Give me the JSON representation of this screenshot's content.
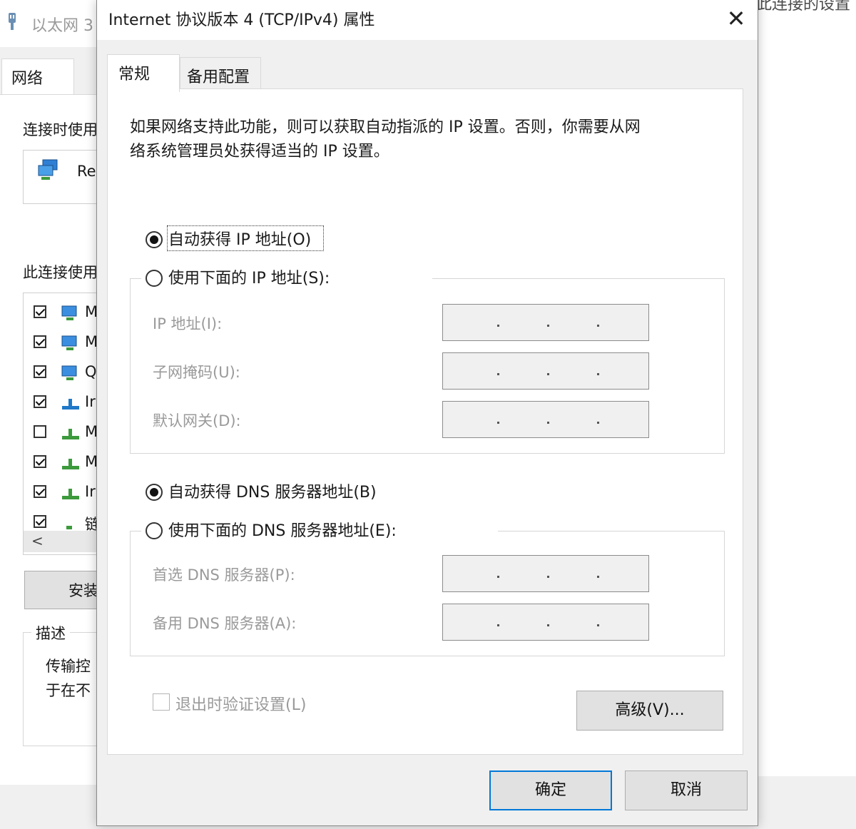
{
  "background_window": {
    "title": "以太网 3",
    "right_title": "此连接的设置",
    "tab_label": "网络",
    "connect_using_label": "连接时使用",
    "adapter_text": "Re",
    "items_label": "此连接使用",
    "items": [
      {
        "checked": true,
        "text": "M"
      },
      {
        "checked": true,
        "text": "M"
      },
      {
        "checked": true,
        "text": "Q"
      },
      {
        "checked": true,
        "text": "Ir"
      },
      {
        "checked": false,
        "text": "M"
      },
      {
        "checked": true,
        "text": "M"
      },
      {
        "checked": true,
        "text": "Ir"
      },
      {
        "checked": true,
        "text": "链"
      }
    ],
    "scroll_left_glyph": "<",
    "install_label": "安装",
    "description_title": "描述",
    "description_line1": "传输控",
    "description_line2": "于在不"
  },
  "dialog": {
    "title": "Internet 协议版本 4 (TCP/IPv4) 属性",
    "close_glyph": "✕",
    "tabs": [
      {
        "label": "常规",
        "selected": true
      },
      {
        "label": "备用配置",
        "selected": false
      }
    ],
    "intro_line1": "如果网络支持此功能，则可以获取自动指派的 IP 设置。否则，你需要从网",
    "intro_line2": "络系统管理员处获得适当的 IP 设置。",
    "ip_auto": {
      "label": "自动获得 IP 地址(O)",
      "selected": true
    },
    "ip_manual": {
      "label": "使用下面的 IP 地址(S):",
      "selected": false
    },
    "ip_fields": [
      {
        "label": "IP 地址(I):",
        "value": ""
      },
      {
        "label": "子网掩码(U):",
        "value": ""
      },
      {
        "label": "默认网关(D):",
        "value": ""
      }
    ],
    "dns_auto": {
      "label": "自动获得 DNS 服务器地址(B)",
      "selected": true
    },
    "dns_manual": {
      "label": "使用下面的 DNS 服务器地址(E):",
      "selected": false
    },
    "dns_fields": [
      {
        "label": "首选 DNS 服务器(P):",
        "value": ""
      },
      {
        "label": "备用 DNS 服务器(A):",
        "value": ""
      }
    ],
    "verify_on_exit": {
      "label": "退出时验证设置(L)",
      "checked": false
    },
    "advanced_button": "高级(V)...",
    "ok_button": "确定",
    "cancel_button": "取消"
  },
  "colors": {
    "accent": "#0078d7",
    "disabled_text": "#9a9a9a",
    "dialog_bg": "#f0f0f0"
  }
}
